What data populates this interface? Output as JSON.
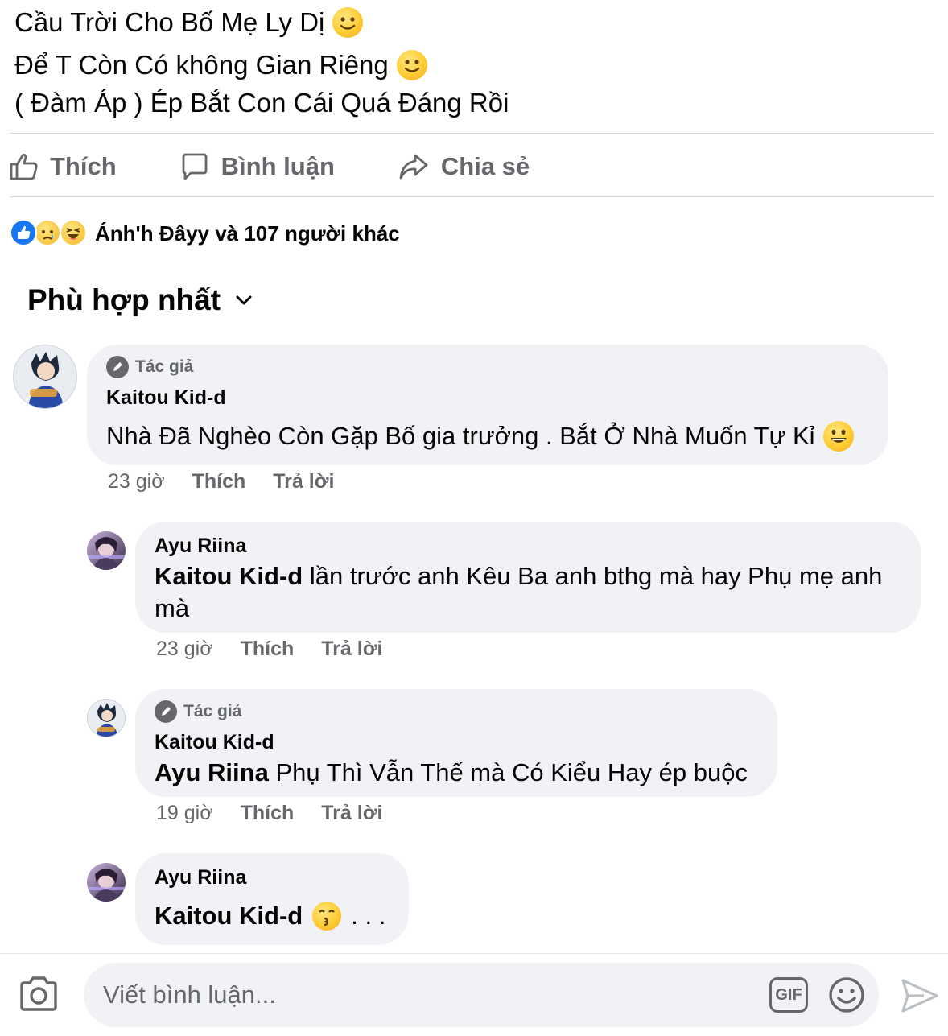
{
  "post": {
    "lines": [
      "Cầu Trời Cho Bố Mẹ Ly Dị",
      "Để T Còn Có không Gian Riêng",
      "( Đàm Áp ) Ép Bắt Con Cái Quá Đáng Rồi"
    ]
  },
  "actions": {
    "like": "Thích",
    "comment": "Bình luận",
    "share": "Chia sẻ"
  },
  "reactions": {
    "summary": "Ánh'h Đâyy và 107 người khác",
    "types": [
      "like-icon",
      "sad-icon",
      "haha-icon"
    ]
  },
  "sort": {
    "label": "Phù hợp nhất"
  },
  "comments": [
    {
      "badge": "Tác giả",
      "author": "Kaitou Kid-d",
      "mention": "",
      "text": "Nhà Đã Nghèo Còn Gặp Bố gia trưởng . Bắt Ở Nhà Muốn Tự Kỉ",
      "time": "23 giờ",
      "like": "Thích",
      "reply": "Trả lời"
    },
    {
      "badge": "",
      "author": "Ayu Riina",
      "mention": "Kaitou Kid-d",
      "text": "lần trước anh Kêu Ba anh bthg mà hay Phụ mẹ anh",
      "text2": "mà",
      "time": "23 giờ",
      "like": "Thích",
      "reply": "Trả lời"
    },
    {
      "badge": "Tác giả",
      "author": "Kaitou Kid-d",
      "mention": "Ayu Riina",
      "text": "Phụ Thì Vẫn Thế mà Có Kiểu Hay ép buộc",
      "time": "19 giờ",
      "like": "Thích",
      "reply": "Trả lời"
    },
    {
      "badge": "",
      "author": "Ayu Riina",
      "mention": "Kaitou Kid-d",
      "text": ". . .",
      "time": "",
      "like": "",
      "reply": ""
    }
  ],
  "composer": {
    "placeholder": "Viết bình luận...",
    "gif": "GIF"
  },
  "colors": {
    "secondary_text": "#65676b",
    "bubble": "#f0f2f5",
    "like_blue": "#1877f2"
  }
}
